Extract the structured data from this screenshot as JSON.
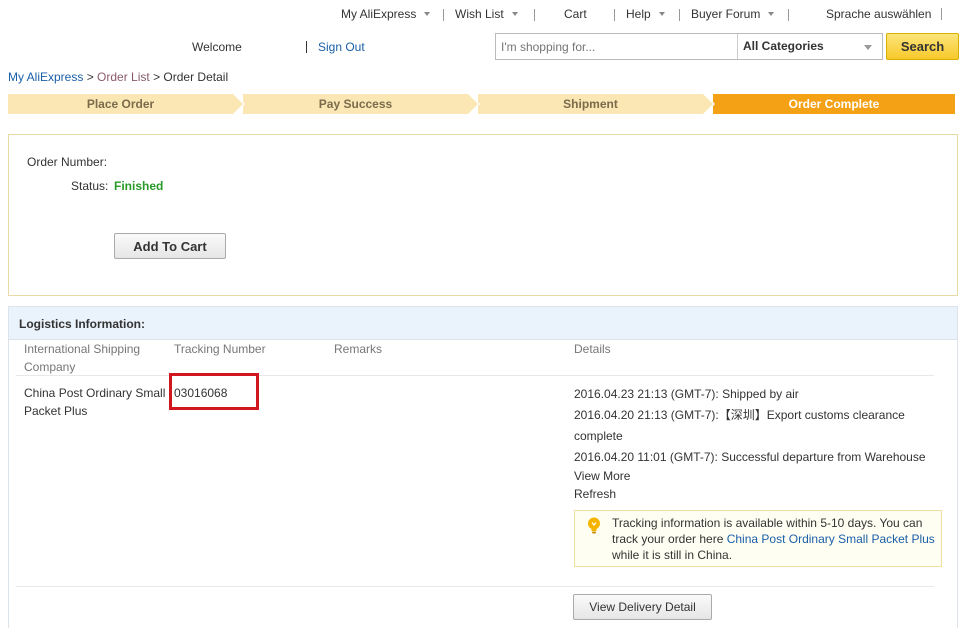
{
  "topnav": {
    "my_aliexpress": "My AliExpress",
    "wish_list": "Wish List",
    "cart": "Cart",
    "help": "Help",
    "buyer_forum": "Buyer Forum",
    "language": "Sprache auswählen"
  },
  "header": {
    "welcome": "Welcome",
    "sign_out": "Sign Out",
    "search_placeholder": "I'm shopping for...",
    "category": "All Categories",
    "search_button": "Search"
  },
  "breadcrumb": {
    "root": "My AliExpress",
    "sep1": " > ",
    "list": "Order List",
    "sep2": " > ",
    "current": "Order Detail"
  },
  "steps": [
    {
      "label": "Place Order"
    },
    {
      "label": "Pay Success"
    },
    {
      "label": "Shipment"
    },
    {
      "label": "Order Complete"
    }
  ],
  "order": {
    "number_label": "Order Number:",
    "number_value": "",
    "status_label": "Status:",
    "status_value": "Finished",
    "add_to_cart": "Add To Cart"
  },
  "logistics": {
    "title": "Logistics Information:",
    "columns": {
      "company": "International Shipping Company",
      "tracking": "Tracking Number",
      "remarks": "Remarks",
      "details": "Details"
    },
    "row": {
      "company": "China Post Ordinary Small Packet Plus",
      "tracking": "03016068",
      "remarks": "",
      "events": [
        "2016.04.23 21:13 (GMT-7): Shipped by air",
        "2016.04.20 21:13 (GMT-7):【深圳】Export customs clearance",
        "complete",
        "2016.04.20 11:01 (GMT-7): Successful departure from Warehouse"
      ],
      "view_more": "View More",
      "refresh": "Refresh"
    },
    "notice": {
      "text_before": "Tracking information is available within 5-10 days. You can track your order here ",
      "link": "China Post Ordinary Small Packet Plus",
      "text_after": " while it is still in China."
    },
    "view_delivery_detail": "View Delivery Detail"
  },
  "colors": {
    "step_active": "#f4a116",
    "step_inactive": "#fbe7b4",
    "status_green": "#2a9a2a",
    "link_blue": "#1a5fa8",
    "highlight_red": "#d0161f",
    "search_yellow": "#f7c92a"
  }
}
